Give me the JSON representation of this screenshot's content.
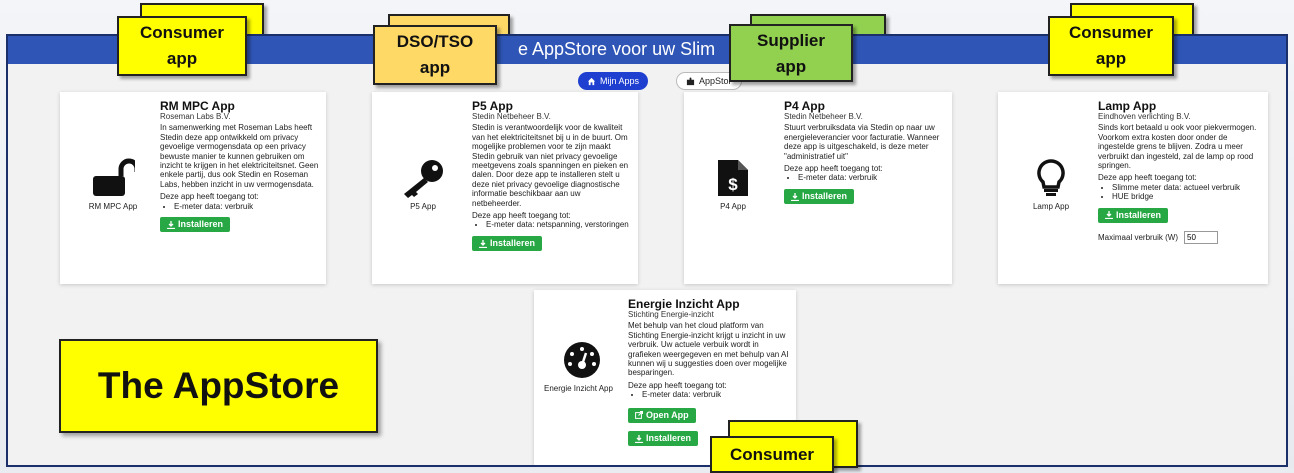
{
  "header": {
    "title": "e AppStore voor uw Slim"
  },
  "tabs": [
    {
      "label": "Mijn Apps",
      "icon": "home-icon"
    },
    {
      "label": "AppStor",
      "icon": "puzzle-icon"
    }
  ],
  "cards": [
    {
      "title": "RM MPC App",
      "org": "Roseman Labs B.V.",
      "desc": "In samenwerking met Roseman Labs heeft Stedin deze app ontwikkeld om privacy gevoelige vermogensdata op een privacy bewuste manier te kunnen gebruiken om inzicht te krijgen in het elektriciteitsnet. Geen enkele partij, dus ook Stedin en Roseman Labs, hebben inzicht in uw vermogensdata.",
      "access_label": "Deze app heeft toegang tot:",
      "access": [
        "E-meter data: verbruik"
      ],
      "install": "Installeren",
      "app_label": "RM MPC App",
      "icon": "unlock-icon"
    },
    {
      "title": "P5 App",
      "org": "Stedin Netbeheer B.V.",
      "desc": "Stedin is verantwoordelijk voor de kwaliteit van het elektriciteitsnet bij u in de buurt. Om mogelijke problemen voor te zijn maakt Stedin gebruik van niet privacy gevoelige meetgevens zoals spanningen en pieken en dalen. Door deze app te installeren stelt u deze niet privacy gevoelige diagnostische informatie beschikbaar aan uw netbeheerder.",
      "access_label": "Deze app heeft toegang tot:",
      "access": [
        "E-meter data: netspanning, verstoringen"
      ],
      "install": "Installeren",
      "app_label": "P5 App",
      "icon": "key-icon"
    },
    {
      "title": "P4 App",
      "org": "Stedin Netbeheer B.V.",
      "desc": "Stuurt verbruiksdata via Stedin op naar uw energieleverancier voor facturatie. Wanneer deze app is uitgeschakeld, is deze meter \"administratief uit\"",
      "access_label": "Deze app heeft toegang tot:",
      "access": [
        "E-meter data: verbruik"
      ],
      "install": "Installeren",
      "app_label": "P4 App",
      "icon": "invoice-icon"
    },
    {
      "title": "Lamp App",
      "org": "Eindhoven verlichting B.V.",
      "desc": "Sinds kort betaald u ook voor piekvermogen. Voorkom extra kosten door onder de ingestelde grens te blijven. Zodra u meer verbruikt dan ingesteld, zal de lamp op rood springen.",
      "access_label": "Deze app heeft toegang tot:",
      "access": [
        "Slimme meter data: actueel verbruik",
        "HUE bridge"
      ],
      "install": "Installeren",
      "app_label": "Lamp App",
      "icon": "lightbulb-icon",
      "max_label": "Maximaal verbruik (W)",
      "max_value": "50"
    },
    {
      "title": "Energie Inzicht App",
      "org": "Stichting Energie-inzicht",
      "desc": "Met behulp van het cloud platform van Stichting Energie-inzicht krijgt u inzicht in uw verbruik. Uw actuele verbuik wordt in grafieken weergegeven en met behulp van AI kunnen wij u suggesties doen over mogelijke besparingen.",
      "access_label": "Deze app heeft toegang tot:",
      "access": [
        "E-meter data: verbruik"
      ],
      "open": "Open App",
      "install": "Installeren",
      "app_label": "Energie Inzicht App",
      "icon": "gauge-icon"
    }
  ],
  "labels": {
    "consumer1": "Consumer app",
    "dso": "DSO/TSO app",
    "supplier": "Supplier app",
    "consumer2": "Consumer app",
    "consumer3": "Consumer",
    "big": "The AppStore"
  },
  "colors": {
    "topbar": "#2f55b6",
    "install_button": "#27a844",
    "consumer_label": "#ffff00",
    "dso_label": "#ffd966",
    "supplier_label": "#92d050"
  }
}
